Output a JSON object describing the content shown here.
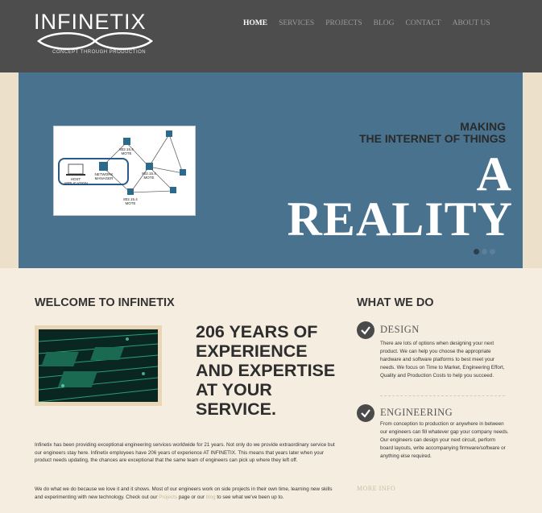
{
  "header": {
    "logo_text": "INFINETIX",
    "logo_tagline": "CONCEPT THROUGH PRODUCTION",
    "nav": [
      "HOME",
      "SERVICES",
      "PROJECTS",
      "BLOG",
      "CONTACT",
      "ABOUT US"
    ]
  },
  "hero": {
    "line1": "MAKING",
    "line2": "THE INTERNET OF THINGS",
    "line3": "A",
    "line4": "REALITY",
    "diagram_labels": {
      "mote_top": "802.15.4\nMOTE",
      "network_manager": "NETWORK\nMANAGER",
      "mote_mid": "802.15.4\nMOTE",
      "mote_bottom": "802.15.4\nMOTE",
      "host": "HOST\nAPPLICATION"
    }
  },
  "welcome": {
    "title": "WELCOME TO INFINETIX",
    "heading": "206 YEARS OF EXPERIENCE AND EXPERTISE AT YOUR SERVICE.",
    "para1": "Infinetix has been providing exceptional engineering services worldwide for 21 years. Not only do we provide extraordinary service but our engineers stay here. Infinetix employees have 206 years of experience AT INFINETIX. This means that years later when your product needs updating, the chances are exceptional that the same team of engineers can pick up where they left off.",
    "para2_a": "We do what we do because we love it and it shows. Most of our engineers work on side projects in their own time, learning new skills and experimenting with new technology. Check out our ",
    "para2_link1": "Projects",
    "para2_b": " page or our ",
    "para2_link2": "blog",
    "para2_c": " to see what we've been up to."
  },
  "what_we_do": {
    "title": "WHAT WE DO",
    "design_title": "DESIGN",
    "design_text": "There are lots of options when designing your next product.  We can help you choose the appropriate hardware and software platforms to best meet your needs.  We focus on Time to Market, Engineering Effort, Quality and Production Costs to help you succeed.",
    "eng_title": "ENGINEERING",
    "eng_text": "From conception to production or anywhere in between our engineers can fill whatever gap your company needs.  Our engineers can design your next circuit, perform board layouts, write accompanying firmware/software or anything else required.",
    "more": "MORE INFO"
  },
  "colors": {
    "header_bg": "#4d4d4d",
    "hero_bg": "#48728d",
    "page_bg": "#f5ede0"
  }
}
